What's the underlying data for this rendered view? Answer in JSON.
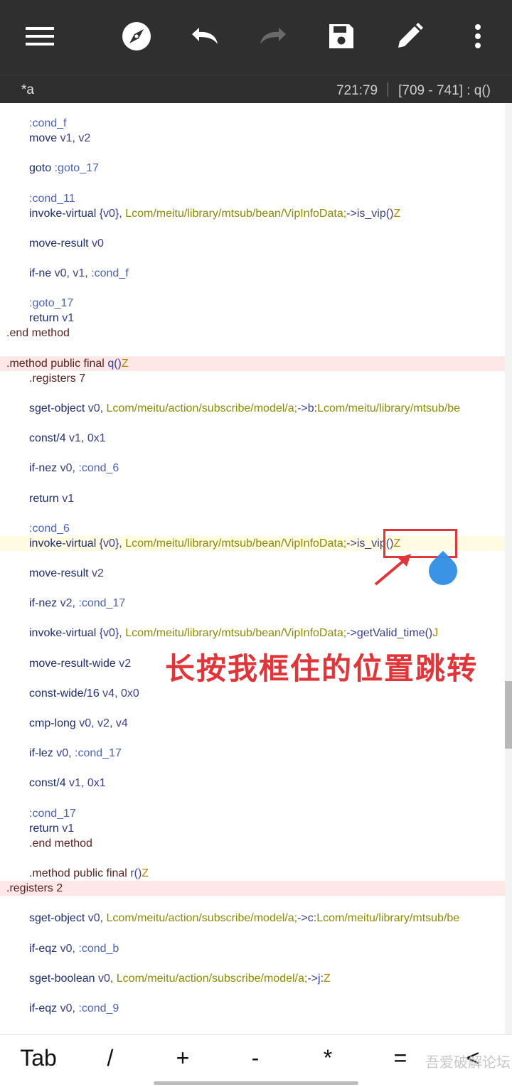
{
  "toolbar": {
    "icons": [
      "menu-icon",
      "compass-icon",
      "undo-icon",
      "redo-icon",
      "save-icon",
      "edit-pencil-icon",
      "more-vert-icon"
    ]
  },
  "status": {
    "file_name": "*a",
    "cursor_position": "721:79",
    "method_range": "[709 - 741] : q()"
  },
  "code_lines": [
    [
      [
        "lbl",
        ":cond_f"
      ]
    ],
    [
      [
        "ins",
        "move "
      ],
      [
        "reg",
        "v1, v2"
      ]
    ],
    [],
    [
      [
        "ins",
        "goto "
      ],
      [
        "lbl",
        ":goto_17"
      ]
    ],
    [],
    [
      [
        "lbl",
        ":cond_11"
      ]
    ],
    [
      [
        "ins",
        "invoke-virtual "
      ],
      [
        "reg",
        "{v0}, "
      ],
      [
        "cls",
        "Lcom/meitu/library/mtsub/bean/VipInfoData;"
      ],
      [
        "reg",
        "->is_vip()"
      ],
      [
        "typ",
        "Z"
      ]
    ],
    [],
    [
      [
        "ins",
        "move-result "
      ],
      [
        "reg",
        "v0"
      ]
    ],
    [],
    [
      [
        "ins",
        "if-ne "
      ],
      [
        "reg",
        "v0, v1, "
      ],
      [
        "lbl",
        ":cond_f"
      ]
    ],
    [],
    [
      [
        "lbl",
        ":goto_17"
      ]
    ],
    [
      [
        "ins",
        "return "
      ],
      [
        "reg",
        "v1"
      ]
    ],
    [
      [
        "dir",
        ".end method"
      ]
    ],
    [],
    [
      [
        "dir",
        ".method public final "
      ],
      [
        "reg",
        "q()"
      ],
      [
        "typ",
        "Z"
      ]
    ],
    [
      [
        "dir",
        ".registers 7"
      ]
    ],
    [],
    [
      [
        "ins",
        "sget-object "
      ],
      [
        "reg",
        "v0, "
      ],
      [
        "cls",
        "Lcom/meitu/action/subscribe/model/a;"
      ],
      [
        "reg",
        "->b:"
      ],
      [
        "cls",
        "Lcom/meitu/library/mtsub/be"
      ]
    ],
    [],
    [
      [
        "ins",
        "const/4 "
      ],
      [
        "reg",
        "v1, 0x1"
      ]
    ],
    [],
    [
      [
        "ins",
        "if-nez "
      ],
      [
        "reg",
        "v0, "
      ],
      [
        "lbl",
        ":cond_6"
      ]
    ],
    [],
    [
      [
        "ins",
        "return "
      ],
      [
        "reg",
        "v1"
      ]
    ],
    [],
    [
      [
        "lbl",
        ":cond_6"
      ]
    ],
    [
      [
        "ins",
        "invoke-virtual "
      ],
      [
        "reg",
        "{v0}, "
      ],
      [
        "cls",
        "Lcom/meitu/library/mtsub/bean/VipInfoData;"
      ],
      [
        "reg",
        "->is_vip()"
      ],
      [
        "typ",
        "Z"
      ]
    ],
    [],
    [
      [
        "ins",
        "move-result "
      ],
      [
        "reg",
        "v2"
      ]
    ],
    [],
    [
      [
        "ins",
        "if-nez "
      ],
      [
        "reg",
        "v2, "
      ],
      [
        "lbl",
        ":cond_17"
      ]
    ],
    [],
    [
      [
        "ins",
        "invoke-virtual "
      ],
      [
        "reg",
        "{v0}, "
      ],
      [
        "cls",
        "Lcom/meitu/library/mtsub/bean/VipInfoData;"
      ],
      [
        "reg",
        "->getValid_time()"
      ],
      [
        "typ",
        "J"
      ]
    ],
    [],
    [
      [
        "ins",
        "move-result-wide "
      ],
      [
        "reg",
        "v2"
      ]
    ],
    [],
    [
      [
        "ins",
        "const-wide/16 "
      ],
      [
        "reg",
        "v4, 0x0"
      ]
    ],
    [],
    [
      [
        "ins",
        "cmp-long "
      ],
      [
        "reg",
        "v0, v2, v4"
      ]
    ],
    [],
    [
      [
        "ins",
        "if-lez "
      ],
      [
        "reg",
        "v0, "
      ],
      [
        "lbl",
        ":cond_17"
      ]
    ],
    [],
    [
      [
        "ins",
        "const/4 "
      ],
      [
        "reg",
        "v1, 0x1"
      ]
    ],
    [],
    [
      [
        "lbl",
        ":cond_17"
      ]
    ],
    [
      [
        "ins",
        "return "
      ],
      [
        "reg",
        "v1"
      ]
    ],
    [
      [
        "dir",
        ".end method"
      ]
    ],
    [],
    [
      [
        "dir",
        ".method public final "
      ],
      [
        "reg",
        "r()"
      ],
      [
        "typ",
        "Z"
      ]
    ],
    [
      [
        "dir",
        ".registers 2"
      ]
    ],
    [],
    [
      [
        "ins",
        "sget-object "
      ],
      [
        "reg",
        "v0, "
      ],
      [
        "cls",
        "Lcom/meitu/action/subscribe/model/a;"
      ],
      [
        "reg",
        "->c:"
      ],
      [
        "cls",
        "Lcom/meitu/library/mtsub/be"
      ]
    ],
    [],
    [
      [
        "ins",
        "if-eqz "
      ],
      [
        "reg",
        "v0, "
      ],
      [
        "lbl",
        ":cond_b"
      ]
    ],
    [],
    [
      [
        "ins",
        "sget-boolean "
      ],
      [
        "reg",
        "v0, "
      ],
      [
        "cls",
        "Lcom/meitu/action/subscribe/model/a;"
      ],
      [
        "reg",
        "->j:"
      ],
      [
        "typ",
        "Z"
      ]
    ],
    [],
    [
      [
        "ins",
        "if-eqz "
      ],
      [
        "reg",
        "v0, "
      ],
      [
        "lbl",
        ":cond_9"
      ]
    ]
  ],
  "annotation": {
    "text": "长按我框住的位置跳转"
  },
  "keys": [
    "Tab",
    "/",
    "+",
    "-",
    "*",
    "=",
    "<"
  ],
  "watermark": "吾爱破解论坛",
  "colors": {
    "toolbar_bg": "#2f2f2f",
    "annotation_red": "#e0363a",
    "method_highlight": "#fde7e7",
    "cursor_line_highlight": "#fffbe3",
    "cursor_handle": "#2f8de4"
  }
}
